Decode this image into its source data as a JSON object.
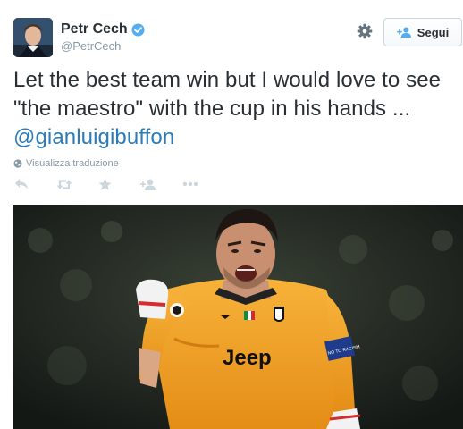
{
  "user": {
    "name": "Petr Cech",
    "handle": "@PetrCech",
    "verified": true
  },
  "follow_button": {
    "label": "Segui"
  },
  "tweet": {
    "text_before": "Let the best team win but I would love to see \"the maestro\" with the cup in his hands ... ",
    "mention": "@gianluigibuffon"
  },
  "translate_label": "Visualizza traduzione",
  "actions": [
    "reply-icon",
    "retweet-icon",
    "favorite-icon",
    "follow-icon",
    "more-icon"
  ],
  "photo": {
    "shirt_text": "Jeep",
    "armband_text": "NO TO RACISM"
  },
  "colors": {
    "link": "#2b7bb9",
    "verified": "#55acee",
    "action_icons": "#ccd6dd",
    "jersey": "#f4a52a"
  }
}
